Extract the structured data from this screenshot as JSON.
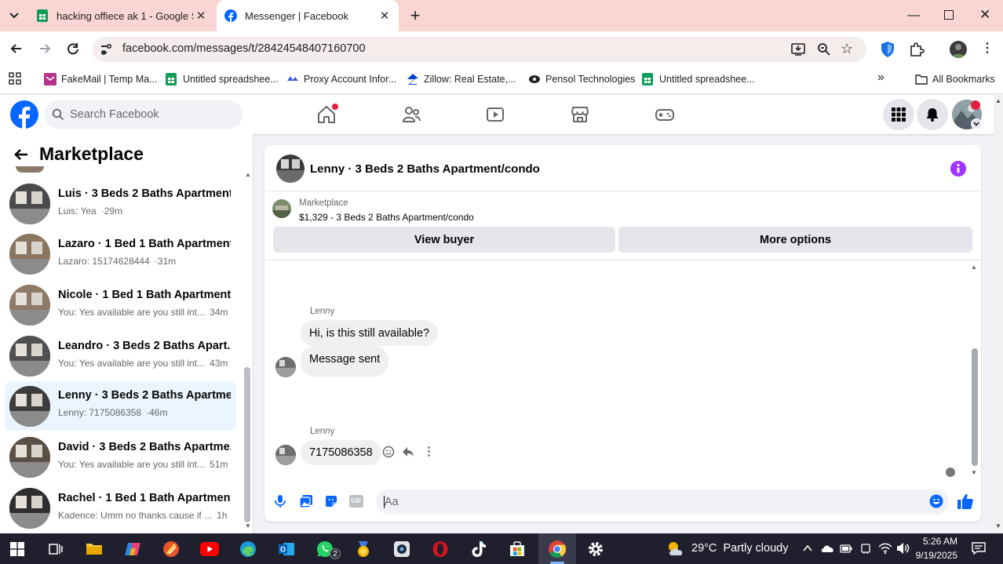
{
  "browser": {
    "tabs": [
      {
        "title": "hacking offiece ak 1 - Google S",
        "active": false
      },
      {
        "title": "Messenger | Facebook",
        "active": true
      }
    ],
    "url": "facebook.com/messages/t/28424548407160700",
    "bookmarks": [
      {
        "label": "FakeMail | Temp Ma..."
      },
      {
        "label": "Untitled spreadshee..."
      },
      {
        "label": "Proxy Account Infor..."
      },
      {
        "label": "Zillow: Real Estate,..."
      },
      {
        "label": "Pensol Technologies"
      },
      {
        "label": "Untitled spreadshee..."
      }
    ],
    "all_bookmarks": "All Bookmarks",
    "overflow": "»"
  },
  "facebook": {
    "search_placeholder": "Search Facebook",
    "sidebar_title": "Marketplace",
    "conversations": [
      {
        "name": "Luis · 3 Beds 2 Baths Apartment...",
        "preview": "Luis: Yea",
        "time": "·29m"
      },
      {
        "name": "Lazaro · 1 Bed 1 Bath Apartment...",
        "preview": "Lazaro: 15174628444",
        "time": "·31m"
      },
      {
        "name": "Nicole · 1 Bed 1 Bath Apartment...",
        "preview": "You: Yes available are you still int...",
        "time": "34m"
      },
      {
        "name": "Leandro · 3 Beds 2 Baths Apart...",
        "preview": "You: Yes available are you still int...",
        "time": "43m"
      },
      {
        "name": "Lenny · 3 Beds 2 Baths Apartme...",
        "preview": "Lenny: 7175086358",
        "time": "·46m"
      },
      {
        "name": "David · 3 Beds 2 Baths Apartme...",
        "preview": "You: Yes available are you still int...",
        "time": "51m"
      },
      {
        "name": "Rachel · 1 Bed 1 Bath Apartment...",
        "preview": "Kadence: Umm no thanks cause if ...",
        "time": "1h"
      }
    ],
    "chat": {
      "title": "Lenny · 3 Beds 2 Baths Apartment/condo",
      "listing_label": "Marketplace",
      "listing_price": "$1,329 - 3 Beds 2 Baths Apartment/condo",
      "view_buyer": "View buyer",
      "more_options": "More options",
      "messages": [
        {
          "sender": "Lenny",
          "text": "Hi, is this still available?"
        },
        {
          "sender": "",
          "text": "Message sent"
        },
        {
          "sender": "Lenny",
          "text": "7175086358"
        }
      ],
      "composer_placeholder": "Aa"
    }
  },
  "taskbar": {
    "weather": "29°C  Partly cloudy",
    "time": "5:26 AM",
    "date": "9/19/2025",
    "whatsapp_badge": "2"
  },
  "colors": {
    "accent": "#0866ff",
    "tabstrip": "#f9d6d3",
    "messenger_purple": "#a033ff"
  }
}
